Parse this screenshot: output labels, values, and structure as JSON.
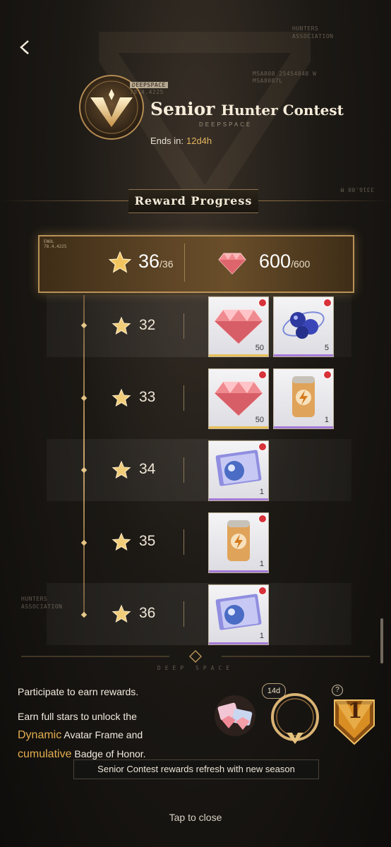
{
  "header": {
    "title_word1": "Senior",
    "title_word2": "Hunter Contest",
    "subtitle": "DEEPSPACE",
    "ends_label": "Ends in:",
    "ends_value": "12d4h"
  },
  "deco": {
    "top_right_1": "HUNTERS",
    "top_right_2": "ASSOCIATION",
    "coords_1": "MSA808 25454848 W",
    "coords_2": "MSA8087L",
    "emblem_tag_1": "DEEPSPACE",
    "emblem_tag_2": "78.4.4225",
    "side_code": "3316.00 M",
    "left_1": "HUNTERS",
    "left_2": "ASSOCIATION",
    "bottom_deco": "DEEP SPACE",
    "summary_tag_1": "ENOL",
    "summary_tag_2": "78.4.4225"
  },
  "section_title": "Reward Progress",
  "summary": {
    "stars": "36",
    "stars_den": "/36",
    "gems": "600",
    "gems_den": "/600"
  },
  "tiers": [
    {
      "stars": "32",
      "rewards": [
        {
          "type": "gem-icon",
          "count": "50",
          "rarity": "#e7c05a"
        },
        {
          "type": "orb-cluster-icon",
          "count": "5",
          "rarity": "#a57bd8"
        }
      ]
    },
    {
      "stars": "33",
      "rewards": [
        {
          "type": "gem-icon",
          "count": "50",
          "rarity": "#e7c05a"
        },
        {
          "type": "energy-can-icon",
          "count": "1",
          "rarity": "#a57bd8"
        }
      ]
    },
    {
      "stars": "34",
      "rewards": [
        {
          "type": "ticket-icon",
          "count": "1",
          "rarity": "#a57bd8"
        }
      ]
    },
    {
      "stars": "35",
      "rewards": [
        {
          "type": "energy-can-icon",
          "count": "1",
          "rarity": "#a57bd8"
        }
      ]
    },
    {
      "stars": "36",
      "rewards": [
        {
          "type": "ticket-icon",
          "count": "1",
          "rarity": "#a57bd8"
        }
      ]
    }
  ],
  "bottom": {
    "line1": "Participate to earn rewards.",
    "line2_a": "Earn full stars to unlock the",
    "line2_hl1": "Dynamic",
    "line2_b": "Avatar Frame and",
    "line2_hl2": "cumulative",
    "line2_c": "Badge of Honor.",
    "frame_badge": "14d",
    "help": "?",
    "honor_rank": "1",
    "notice": "Senior Contest rewards refresh with new season",
    "tap_close": "Tap to close"
  },
  "colors": {
    "accent_gold": "#e3ae4f",
    "red_dot": "#d8323a",
    "rarity_gold": "#e7c05a",
    "rarity_purple": "#a57bd8"
  }
}
